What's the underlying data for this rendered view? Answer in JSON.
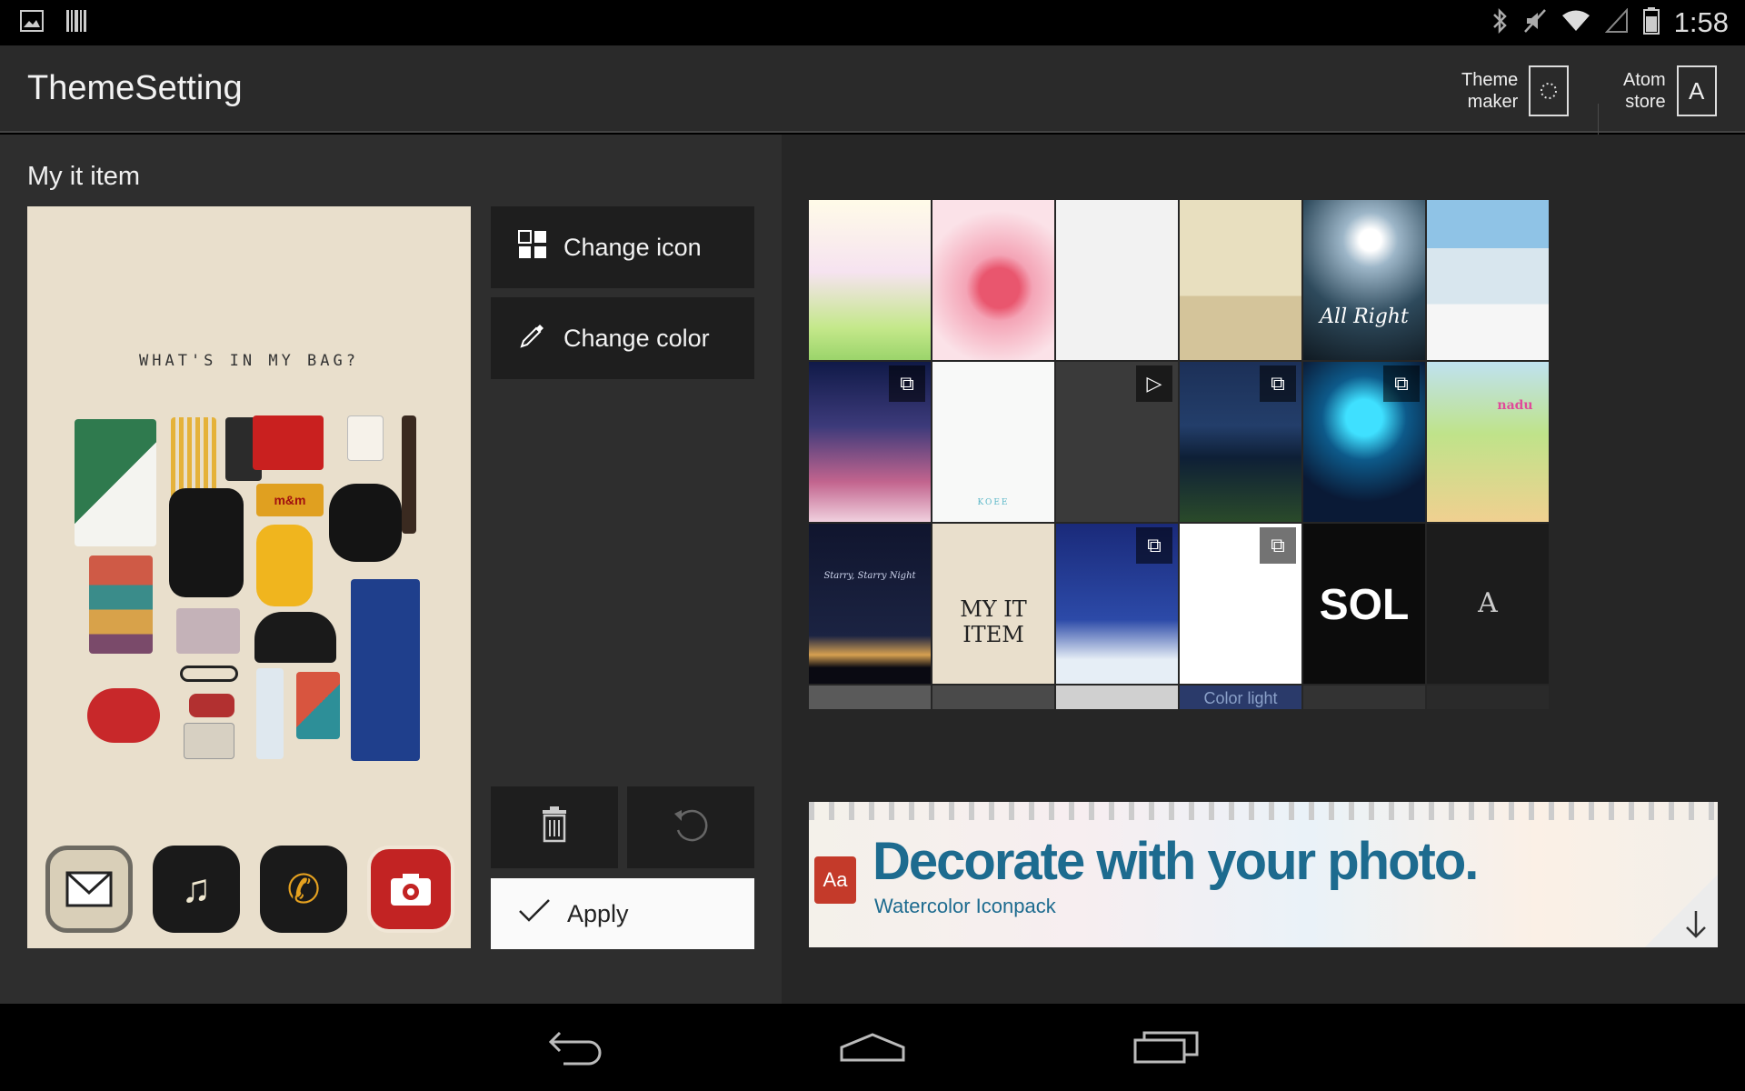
{
  "status_bar": {
    "clock": "1:58",
    "left_icons": [
      "gallery-icon",
      "barcode-icon"
    ],
    "right_icons": [
      "bluetooth-icon",
      "mute-icon",
      "wifi-icon",
      "signal-icon",
      "battery-icon"
    ]
  },
  "action_bar": {
    "title": "ThemeSetting",
    "theme_maker": {
      "line1": "Theme",
      "line2": "maker"
    },
    "atom_store": {
      "line1": "Atom",
      "line2": "store",
      "glyph": "A"
    }
  },
  "panel": {
    "section_title": "My it item",
    "preview": {
      "caption": "WHAT'S IN MY BAG?",
      "candy_label": "m&m"
    },
    "buttons": {
      "change_icon": "Change icon",
      "change_color": "Change color",
      "apply": "Apply"
    }
  },
  "themes": {
    "tiles": [
      {
        "id": "princess"
      },
      {
        "id": "cherry-blossom"
      },
      {
        "id": "cartoon-icons"
      },
      {
        "id": "tea-room"
      },
      {
        "id": "all-right",
        "text": "All Right"
      },
      {
        "id": "snow-town"
      },
      {
        "id": "starry-trees",
        "badge": "copy"
      },
      {
        "id": "penguins",
        "text": "KOEE"
      },
      {
        "id": "robot-face",
        "badge": "play"
      },
      {
        "id": "starry-night-river",
        "badge": "copy"
      },
      {
        "id": "fireworks",
        "badge": "copy"
      },
      {
        "id": "nadu",
        "text": "nadu"
      },
      {
        "id": "starry-starry-night",
        "text": "Starry, Starry Night"
      },
      {
        "id": "my-it-item",
        "text": "MY IT ITEM"
      },
      {
        "id": "little-prince",
        "badge": "copy"
      },
      {
        "id": "castle",
        "badge": "copy"
      },
      {
        "id": "black-typo",
        "text": "SOL"
      },
      {
        "id": "dark-atom",
        "text": "A"
      }
    ],
    "partial_row_text": "Color light"
  },
  "banner": {
    "headline": "Decorate with your photo.",
    "subtitle": "Watercolor Iconpack",
    "badge": "Aa"
  },
  "nav": [
    "back-icon",
    "home-icon",
    "recent-apps-icon"
  ]
}
